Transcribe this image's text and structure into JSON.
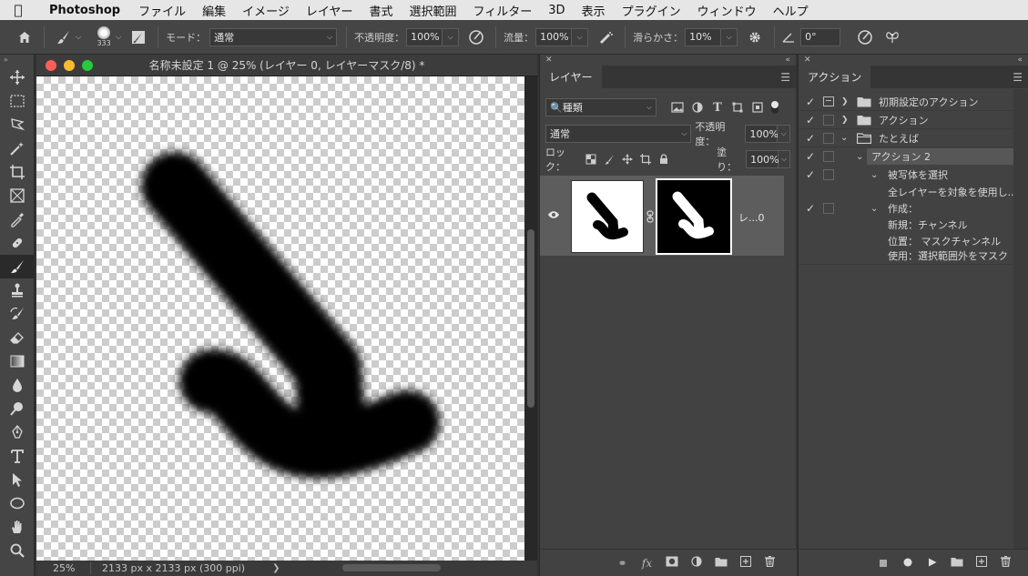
{
  "menubar": {
    "app_name": "Photoshop",
    "items": [
      "ファイル",
      "編集",
      "イメージ",
      "レイヤー",
      "書式",
      "選択範囲",
      "フィルター",
      "3D",
      "表示",
      "プラグイン",
      "ウィンドウ",
      "ヘルプ"
    ]
  },
  "options_bar": {
    "brush_size": "333",
    "mode_label": "モード：",
    "mode_value": "通常",
    "opacity_label": "不透明度：",
    "opacity_value": "100%",
    "flow_label": "流量：",
    "flow_value": "100%",
    "smoothing_label": "滑らかさ：",
    "smoothing_value": "10%",
    "angle_value": "0°"
  },
  "document": {
    "title": "名称未設定 1 @ 25% (レイヤー 0, レイヤーマスク/8) *",
    "zoom": "25%",
    "dimensions": "2133 px x 2133 px (300 ppi)"
  },
  "layers_panel": {
    "tab": "レイヤー",
    "filter_kind": "種類",
    "blend_mode": "通常",
    "opacity_label": "不透明度：",
    "opacity_value": "100%",
    "lock_label": "ロック：",
    "fill_label": "塗り：",
    "fill_value": "100%",
    "layer_name": "レ...0"
  },
  "actions_panel": {
    "tab": "アクション",
    "items": [
      "初期設定のアクション",
      "アクション",
      "たとえば",
      "アクション 2",
      "被写体を選択",
      "全レイヤーを対象を使用し...",
      "作成：",
      "新規：チャンネル",
      "位置：  マスクチャンネル",
      "使用：選択範囲外をマスク"
    ]
  },
  "colors": {
    "panel_bg": "#424242",
    "selected_layer": "#5d5d5d",
    "selected_action": "#575757"
  }
}
